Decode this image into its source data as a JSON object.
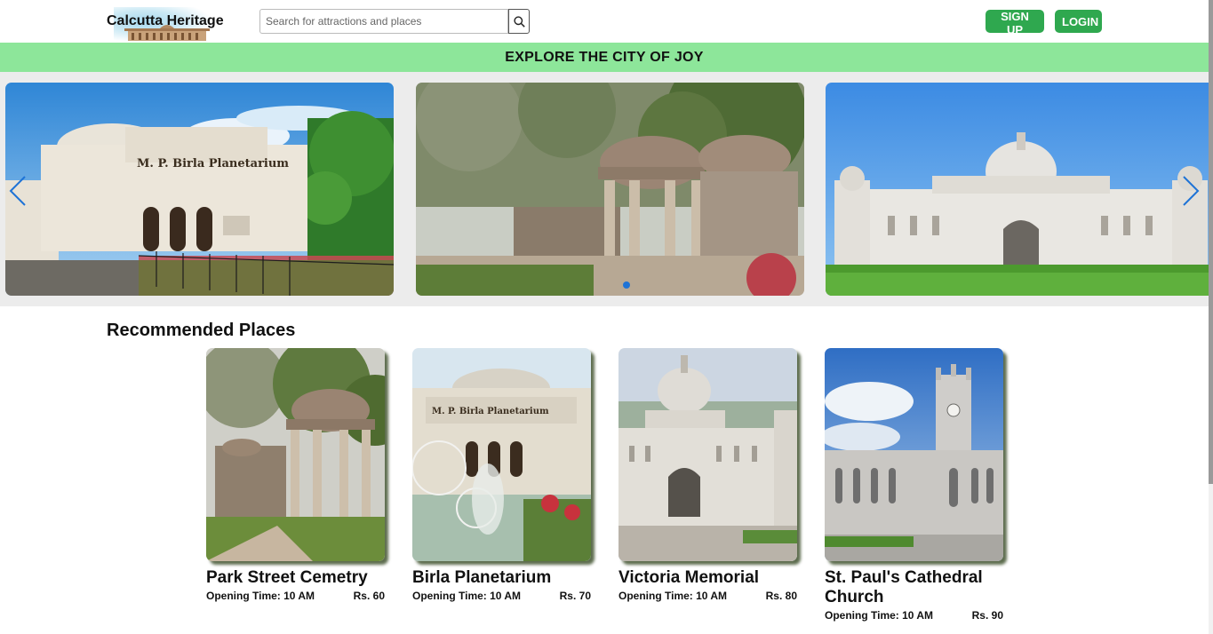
{
  "header": {
    "logo_text": "Calcutta Heritage",
    "search_placeholder": "Search for attractions and places",
    "search_icon": "search-icon",
    "signup_label": "SIGN UP",
    "login_label": "LOGIN"
  },
  "banner": {
    "text": "EXPLORE THE CITY OF JOY"
  },
  "carousel": {
    "slides": [
      {
        "image": "birla-planetarium-photo",
        "sign_text": "M. P. Birla Planetarium"
      },
      {
        "image": "park-street-cemetery-photo"
      },
      {
        "image": "victoria-memorial-photo"
      }
    ],
    "prev_icon": "chevron-left-icon",
    "next_icon": "chevron-right-icon"
  },
  "recommended": {
    "title": "Recommended Places",
    "places": [
      {
        "name": "Park Street Cemetry",
        "opening": "Opening Time: 10 AM",
        "price": "Rs. 60"
      },
      {
        "name": "Birla Planetarium",
        "opening": "Opening Time: 10 AM",
        "price": "Rs. 70",
        "sign_text": "M. P. Birla Planetarium"
      },
      {
        "name": "Victoria Memorial",
        "opening": "Opening Time: 10 AM",
        "price": "Rs. 80"
      },
      {
        "name": "St. Paul's Cathedral Church",
        "opening": "Opening Time: 10 AM",
        "price": "Rs. 90"
      }
    ]
  },
  "colors": {
    "accent_green": "#2fa84f",
    "banner_green": "#8de69a",
    "carousel_bg": "#ececec",
    "arrow_blue": "#1e73d6"
  }
}
